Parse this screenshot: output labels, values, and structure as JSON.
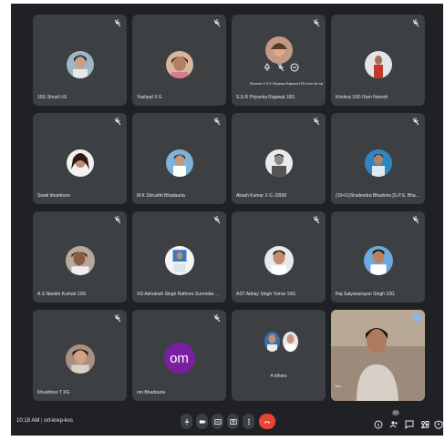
{
  "tiles": [
    {
      "name": "10G Shruti US"
    },
    {
      "name": "Yashpal X G"
    },
    {
      "name": "S.S.R Priyanka Rajawat 10G",
      "tooltip": "Remove S.S.R Priyanka Rajawat 10G from the call"
    },
    {
      "name": "Krishna 10G Ram Naresh"
    },
    {
      "name": "Swati bhambore"
    },
    {
      "name": "M.K Shrushti Bhadauria"
    },
    {
      "name": "Akash Kumar X G J3999"
    },
    {
      "name": "(10<G)Shailendra Bhadoria [S.P.S. Bhadoria]"
    },
    {
      "name": "A.S Nandni Kumari 10G"
    },
    {
      "name": "XG Ashutosh Singh Rathore Surendar Sin..."
    },
    {
      "name": "AST Abhay Singh Tomar 10G"
    },
    {
      "name": "Raj Satyanarayan Singh 10G"
    },
    {
      "name": "Khushboo T XG"
    },
    {
      "name": "om Bhadouria",
      "initials": "om"
    },
    {
      "name": "4 others"
    },
    {
      "name": "You"
    }
  ],
  "bottom_bar": {
    "time": "10:19 AM",
    "separator": "|",
    "meeting_code": "ort-krep-kvs",
    "participant_badge": "17"
  },
  "colors": {
    "background": "#202124",
    "tile": "#3c4043",
    "hangup": "#ea4335",
    "om_avatar": "#7b1fa2",
    "active_outline": "#8ab4f8"
  }
}
